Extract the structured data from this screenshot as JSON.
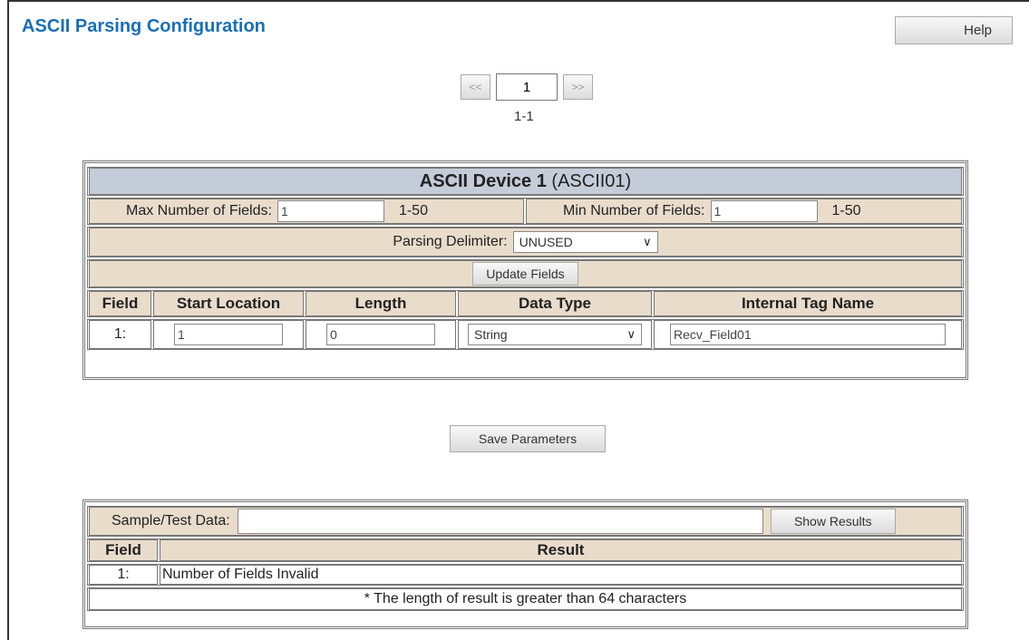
{
  "page": {
    "title": "ASCII Parsing Configuration",
    "help_label": "Help"
  },
  "pager": {
    "prev_label": "<<",
    "current_page": "1",
    "next_label": ">>",
    "range": "1-1"
  },
  "device": {
    "name": "ASCII Device 1",
    "id": "(ASCII01)",
    "max_fields_label": "Max Number of Fields:",
    "max_fields_value": "1",
    "max_fields_range": "1-50",
    "min_fields_label": "Min Number of Fields:",
    "min_fields_value": "1",
    "min_fields_range": "1-50",
    "delimiter_label": "Parsing Delimiter:",
    "delimiter_value": "UNUSED",
    "update_label": "Update Fields"
  },
  "fields_table": {
    "headers": [
      "Field",
      "Start Location",
      "Length",
      "Data Type",
      "Internal Tag Name"
    ],
    "rows": [
      {
        "field": "1:",
        "start": "1",
        "length": "0",
        "data_type": "String",
        "tag": "Recv_Field01"
      }
    ]
  },
  "save_label": "Save Parameters",
  "test": {
    "label": "Sample/Test Data:",
    "value": "",
    "show_label": "Show Results",
    "headers": [
      "Field",
      "Result"
    ],
    "rows": [
      {
        "field": "1:",
        "result": "Number of Fields Invalid"
      }
    ],
    "note": "* The length of result is greater than 64 characters"
  },
  "colors": {
    "title": "#1a6fb5",
    "header_blue": "#c5ccd9",
    "header_tan": "#e9dccb"
  },
  "icons": {
    "dropdown": "chevron-down-icon"
  }
}
